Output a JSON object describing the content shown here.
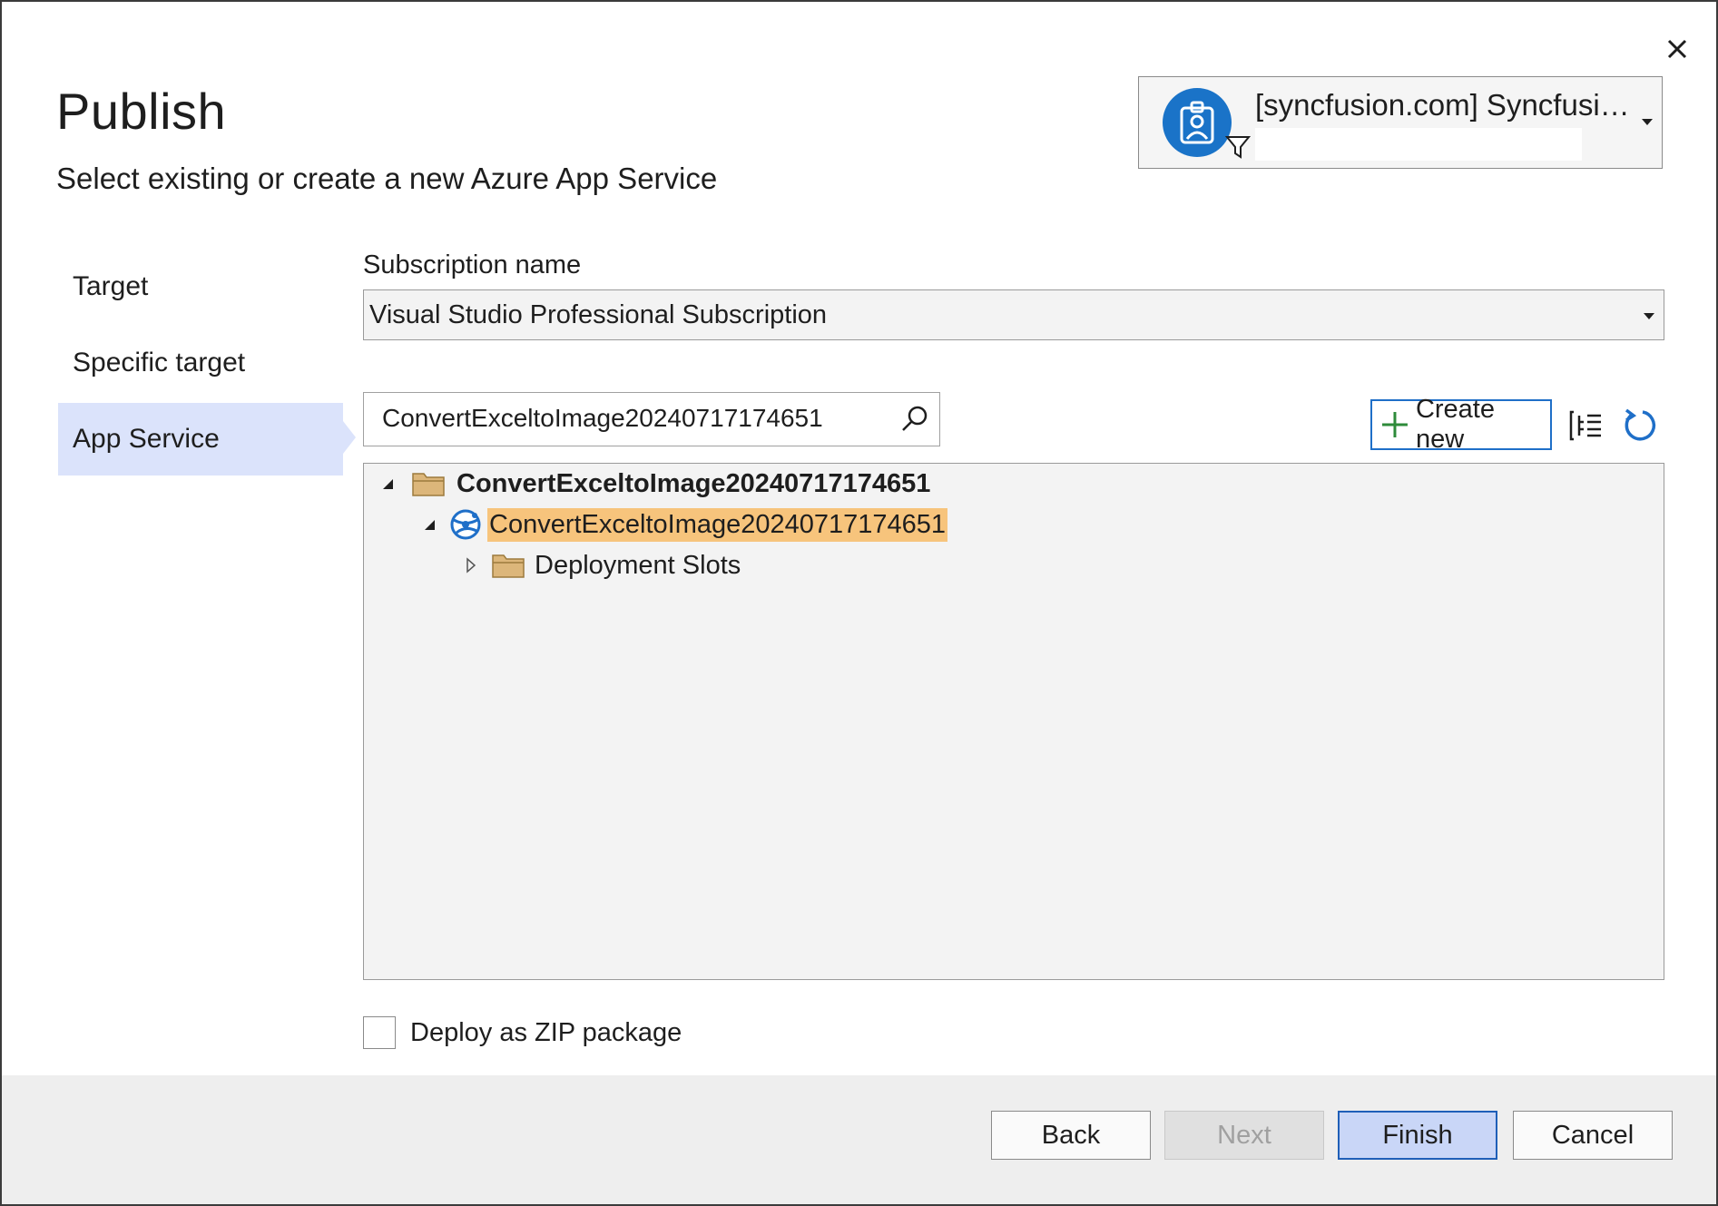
{
  "dialog": {
    "title": "Publish",
    "subtitle": "Select existing or create a new Azure App Service"
  },
  "account": {
    "name": "[syncfusion.com] Syncfusi…",
    "avatar_icon": "badge-icon",
    "filter_icon": "filter-icon",
    "accent": "#1a73c8"
  },
  "nav": {
    "items": [
      {
        "label": "Target",
        "active": false
      },
      {
        "label": "Specific target",
        "active": false
      },
      {
        "label": "App Service",
        "active": true
      }
    ]
  },
  "subscription": {
    "label": "Subscription name",
    "value": "Visual Studio Professional Subscription"
  },
  "search": {
    "value": "ConvertExceltoImage20240717174651"
  },
  "toolbar": {
    "create_new_label": "Create new",
    "view_icon": "tree-view-icon",
    "refresh_icon": "refresh-icon"
  },
  "tree": {
    "resource_group": "ConvertExceltoImage20240717174651",
    "app_service": "ConvertExceltoImage20240717174651",
    "deployment_slots": "Deployment Slots"
  },
  "options": {
    "zip_label": "Deploy as ZIP package",
    "zip_checked": false
  },
  "footer": {
    "back_label": "Back",
    "next_label": "Next",
    "finish_label": "Finish",
    "cancel_label": "Cancel"
  },
  "colors": {
    "nav_active": "#dbe3fb",
    "selection": "#f7c47c",
    "primary_button": "#c9d6f7",
    "primary_border": "#1f5fb8"
  }
}
